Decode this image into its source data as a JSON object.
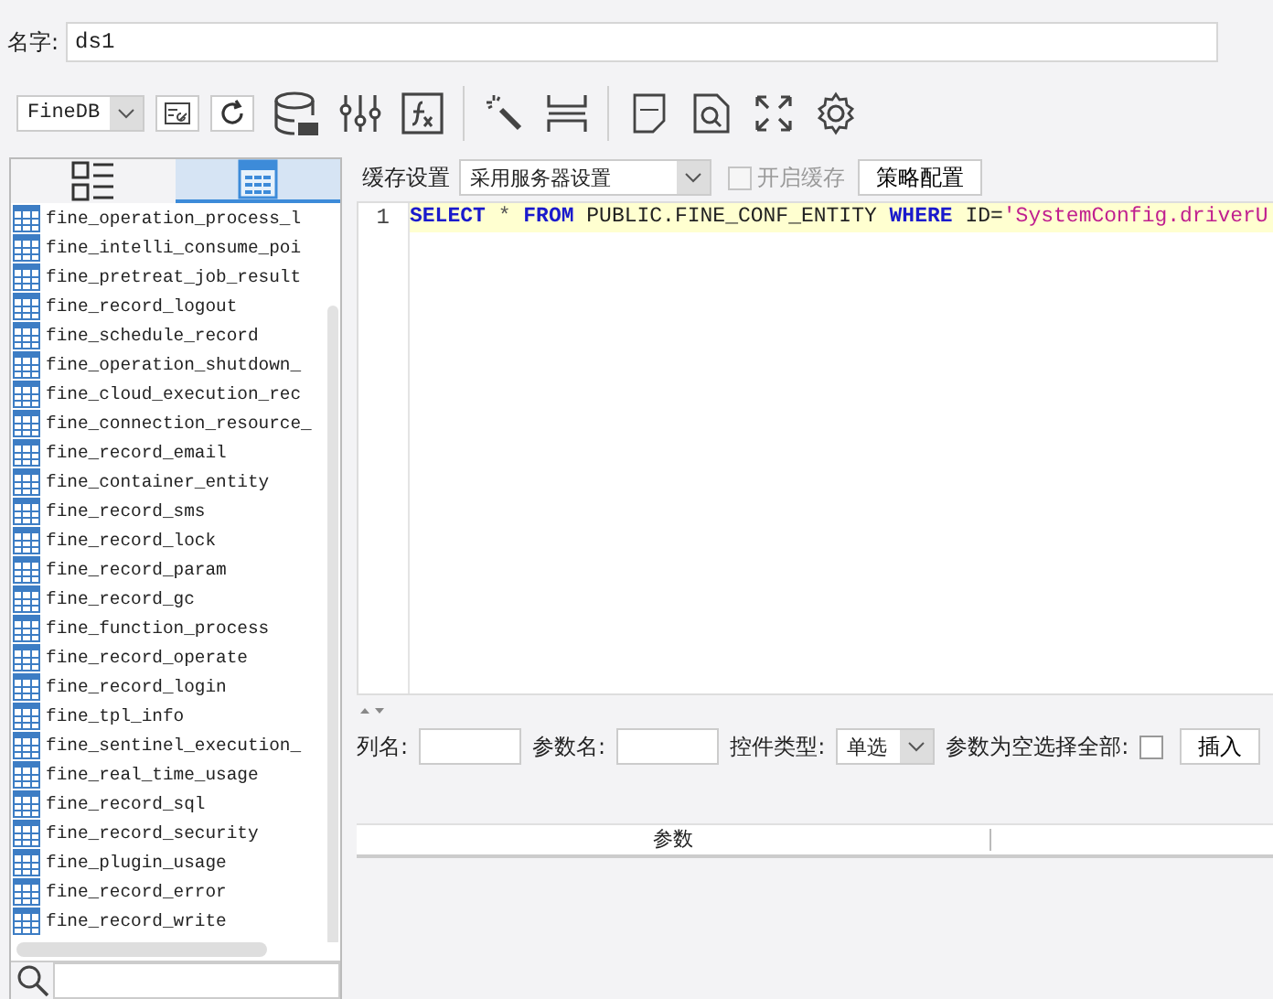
{
  "name_field": {
    "label": "名字:",
    "value": "ds1"
  },
  "toolbar": {
    "datasource": "FineDB"
  },
  "panel_tabs": [
    {
      "kind": "list",
      "selected": false
    },
    {
      "kind": "table",
      "selected": true
    }
  ],
  "tables": [
    "fine_operation_process_l",
    "fine_intelli_consume_poi",
    "fine_pretreat_job_result",
    "fine_record_logout",
    "fine_schedule_record",
    "fine_operation_shutdown_",
    "fine_cloud_execution_rec",
    "fine_connection_resource_",
    "fine_record_email",
    "fine_container_entity",
    "fine_record_sms",
    "fine_record_lock",
    "fine_record_param",
    "fine_record_gc",
    "fine_function_process",
    "fine_record_operate",
    "fine_record_login",
    "fine_tpl_info",
    "fine_sentinel_execution_",
    "fine_real_time_usage",
    "fine_record_sql",
    "fine_record_security",
    "fine_plugin_usage",
    "fine_record_error",
    "fine_record_write"
  ],
  "cache": {
    "label": "缓存设置",
    "value": "采用服务器设置",
    "enable_label": "开启缓存",
    "enable_checked": false,
    "enable_disabled": true,
    "policy_button": "策略配置"
  },
  "editor": {
    "line_number": "1",
    "tokens": [
      {
        "kind": "keyword",
        "text": "SELECT"
      },
      {
        "kind": "operator",
        "text": " * "
      },
      {
        "kind": "keyword",
        "text": "FROM"
      },
      {
        "kind": "plain",
        "text": " PUBLIC.FINE_CONF_ENTITY "
      },
      {
        "kind": "keyword",
        "text": "WHERE"
      },
      {
        "kind": "plain",
        "text": " ID="
      },
      {
        "kind": "string",
        "text": "'SystemConfig.driverU"
      }
    ]
  },
  "params_form": {
    "column_label": "列名:",
    "param_label": "参数名:",
    "control_label": "控件类型:",
    "control_value": "单选",
    "empty_all_label": "参数为空选择全部:",
    "empty_all_checked": false,
    "insert_button": "插入"
  },
  "param_table": {
    "columns": [
      "参数"
    ]
  }
}
